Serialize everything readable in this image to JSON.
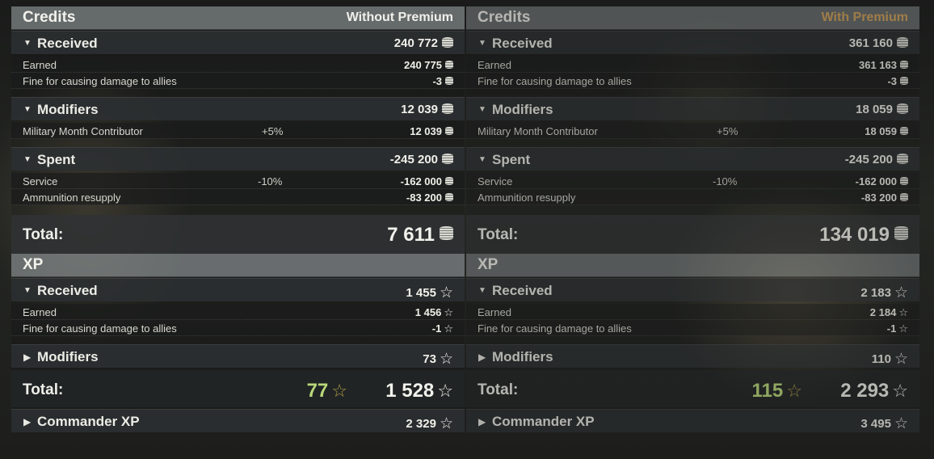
{
  "without_premium": {
    "credits_title": "Credits",
    "mode_label": "Without Premium",
    "received": {
      "label": "Received",
      "value": "240 772"
    },
    "earned": {
      "label": "Earned",
      "value": "240 775"
    },
    "fine": {
      "label": "Fine for causing damage to allies",
      "value": "-3"
    },
    "modifiers": {
      "label": "Modifiers",
      "value": "12 039"
    },
    "military_month": {
      "label": "Military Month Contributor",
      "pct": "+5%",
      "value": "12 039"
    },
    "spent": {
      "label": "Spent",
      "value": "-245 200"
    },
    "service": {
      "label": "Service",
      "pct": "-10%",
      "value": "-162 000"
    },
    "ammo": {
      "label": "Ammunition resupply",
      "value": "-83 200"
    },
    "credits_total": {
      "label": "Total:",
      "value": "7 611"
    },
    "xp_title": "XP",
    "xp_received": {
      "label": "Received",
      "value": "1 455"
    },
    "xp_earned": {
      "label": "Earned",
      "value": "1 456"
    },
    "xp_fine": {
      "label": "Fine for causing damage to allies",
      "value": "-1"
    },
    "xp_modifiers": {
      "label": "Modifiers",
      "value": "73"
    },
    "xp_total": {
      "label": "Total:",
      "bonus": "77",
      "value": "1 528"
    },
    "commander_xp": {
      "label": "Commander XP",
      "value": "2 329"
    }
  },
  "with_premium": {
    "credits_title": "Credits",
    "mode_label": "With Premium",
    "received": {
      "label": "Received",
      "value": "361 160"
    },
    "earned": {
      "label": "Earned",
      "value": "361 163"
    },
    "fine": {
      "label": "Fine for causing damage to allies",
      "value": "-3"
    },
    "modifiers": {
      "label": "Modifiers",
      "value": "18 059"
    },
    "military_month": {
      "label": "Military Month Contributor",
      "pct": "+5%",
      "value": "18 059"
    },
    "spent": {
      "label": "Spent",
      "value": "-245 200"
    },
    "service": {
      "label": "Service",
      "pct": "-10%",
      "value": "-162 000"
    },
    "ammo": {
      "label": "Ammunition resupply",
      "value": "-83 200"
    },
    "credits_total": {
      "label": "Total:",
      "value": "134 019"
    },
    "xp_title": "XP",
    "xp_received": {
      "label": "Received",
      "value": "2 183"
    },
    "xp_earned": {
      "label": "Earned",
      "value": "2 184"
    },
    "xp_fine": {
      "label": "Fine for causing damage to allies",
      "value": "-1"
    },
    "xp_modifiers": {
      "label": "Modifiers",
      "value": "110"
    },
    "xp_total": {
      "label": "Total:",
      "bonus": "115",
      "value": "2 293"
    },
    "commander_xp": {
      "label": "Commander XP",
      "value": "3 495"
    }
  },
  "icons": {
    "credits": "credit-coin-icon",
    "xp": "xp-star-icon",
    "expanded": "triangle-down-icon",
    "collapsed": "triangle-right-icon"
  },
  "colors": {
    "premium_label": "#d2a35a",
    "bonus_xp": "#b9d87a"
  }
}
